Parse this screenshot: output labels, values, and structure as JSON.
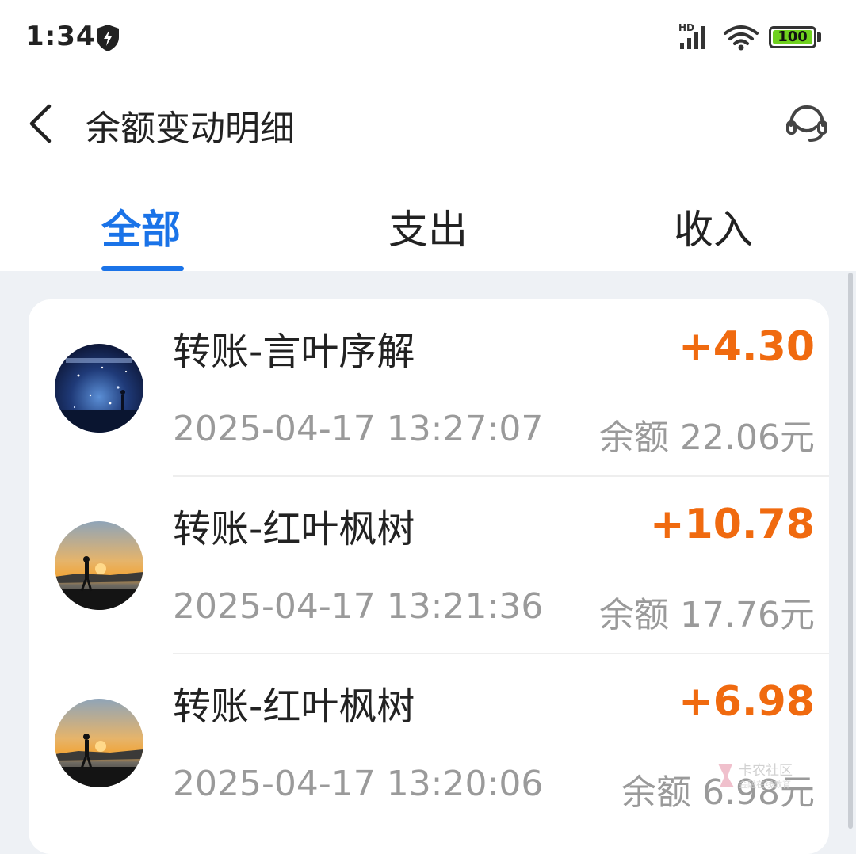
{
  "status_bar": {
    "time": "1:34",
    "network": "HD",
    "battery": "100"
  },
  "header": {
    "title": "余额变动明细"
  },
  "tabs": [
    {
      "label": "全部",
      "active": true
    },
    {
      "label": "支出",
      "active": false
    },
    {
      "label": "收入",
      "active": false
    }
  ],
  "transactions": [
    {
      "title": "转账-言叶序解",
      "amount": "+4.30",
      "time": "2025-04-17 13:27:07",
      "balance": "余额 22.06元",
      "avatar": "night-sky-avatar"
    },
    {
      "title": "转账-红叶枫树",
      "amount": "+10.78",
      "time": "2025-04-17 13:21:36",
      "balance": "余额 17.76元",
      "avatar": "sunset-avatar"
    },
    {
      "title": "转账-红叶枫树",
      "amount": "+6.98",
      "time": "2025-04-17 13:20:06",
      "balance": "余额 6.98元",
      "avatar": "sunset-avatar"
    }
  ],
  "watermark": {
    "text": "卡农社区",
    "subtext": "金融在线教育"
  },
  "colors": {
    "accent": "#1a73e8",
    "amount": "#f06a0f",
    "muted": "#9a9a9a",
    "background": "#eef1f5"
  }
}
